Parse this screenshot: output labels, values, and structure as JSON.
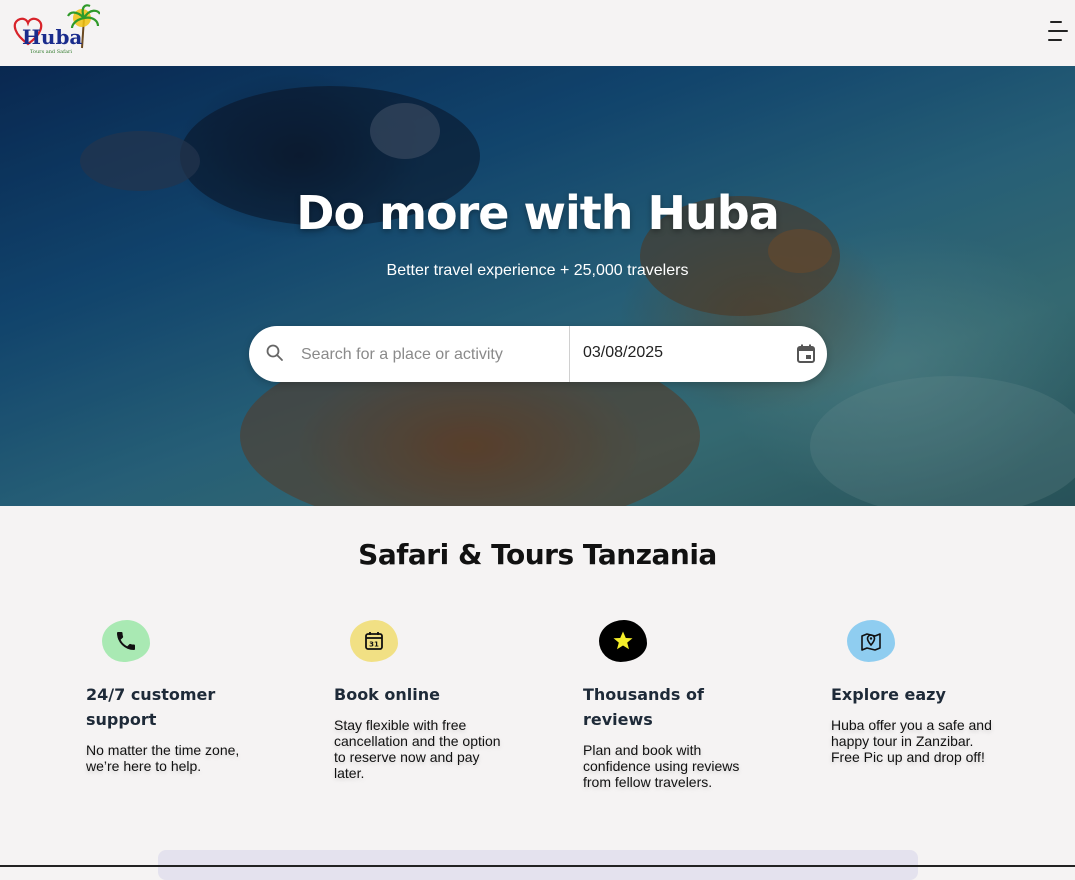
{
  "header": {
    "logo_text": "Huba",
    "logo_tagline": "Tours and Safari",
    "menu_icon": "hamburger-menu-icon"
  },
  "hero": {
    "title": "Do more with Huba",
    "subtitle": "Better travel experience + 25,000 travelers",
    "search": {
      "placeholder": "Search for a place or activity",
      "value": "",
      "icon": "search-icon"
    },
    "date": {
      "value": "03/08/2025",
      "icon": "calendar-icon"
    }
  },
  "section": {
    "title": "Safari & Tours Tanzania"
  },
  "features": [
    {
      "icon": "phone-icon",
      "color": "#a9e9b3",
      "title": "24/7 customer support",
      "description": "No matter the time zone, we’re here to help."
    },
    {
      "icon": "calendar-icon",
      "color": "#f1e084",
      "title": "Book online",
      "description": "Stay flexible with free cancellation and the option to reserve now and pay later."
    },
    {
      "icon": "star-icon",
      "color": "#000000",
      "title": "Thousands of reviews",
      "description": "Plan and book with confidence using reviews from fellow travelers."
    },
    {
      "icon": "map-pin-icon",
      "color": "#8fcdf0",
      "title": "Explore eazy",
      "description": "Huba offer you a safe and happy tour in Zanzibar. Free Pic up and drop off!"
    }
  ]
}
